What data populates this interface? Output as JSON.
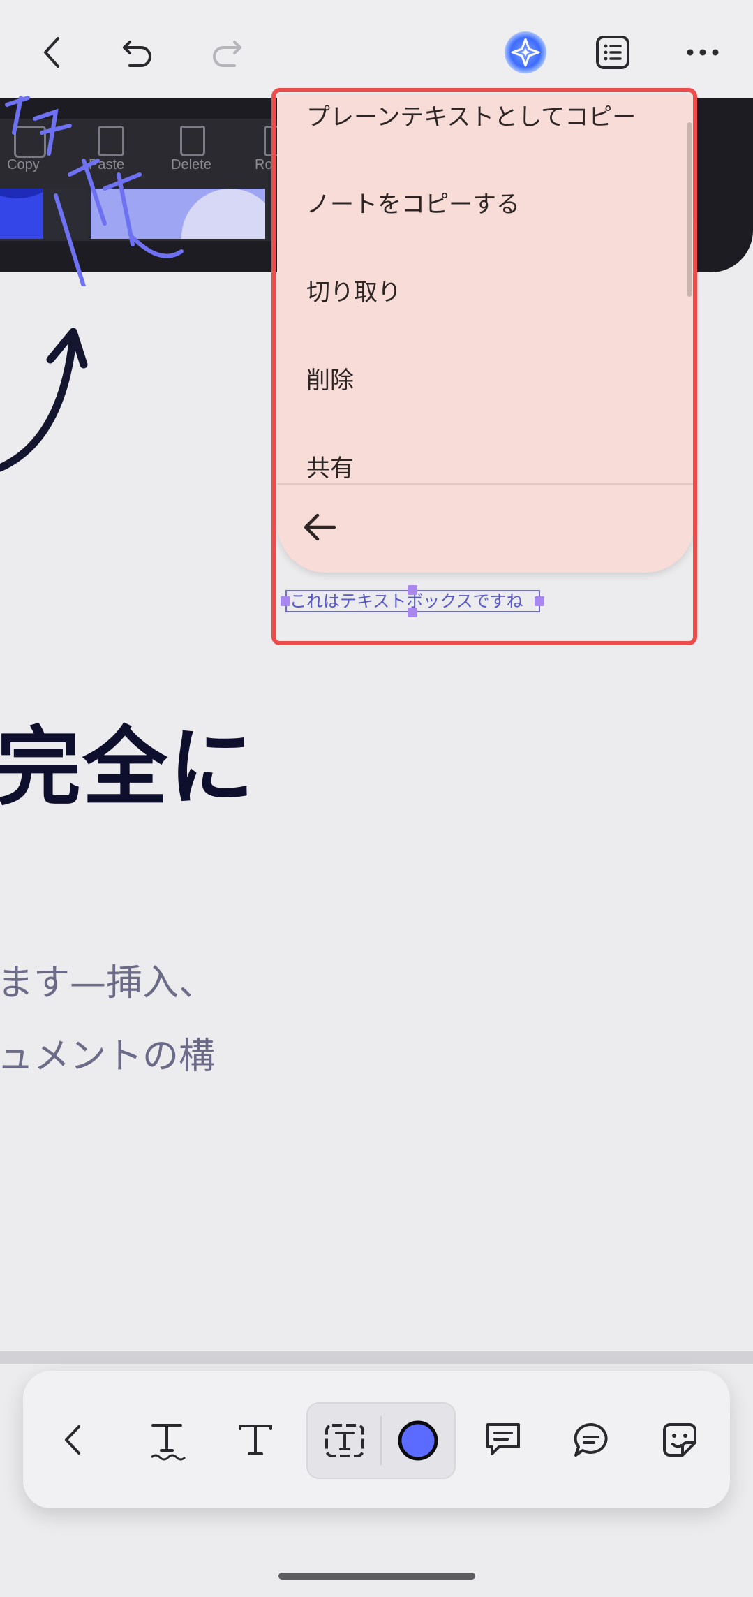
{
  "menu": {
    "items": [
      {
        "label": "プレーンテキストとしてコピー"
      },
      {
        "label": "ノートをコピーする"
      },
      {
        "label": "切り取り"
      },
      {
        "label": "削除"
      },
      {
        "label": "共有"
      }
    ]
  },
  "embedded_screenshot": {
    "tool_labels": [
      "Copy",
      "Paste",
      "Delete",
      "Ro"
    ],
    "handwriting": "モダン秘"
  },
  "textbox": {
    "value": "これはテキストボックスですね"
  },
  "content": {
    "heading": "完全に",
    "body_line_1": "ます—挿入、",
    "body_line_2": "ュメントの構"
  },
  "colors": {
    "highlight": "#EE4B4B",
    "menu_bg": "#F7DCD8",
    "accent": "#5B6BFF",
    "heading": "#0E0F2D"
  }
}
